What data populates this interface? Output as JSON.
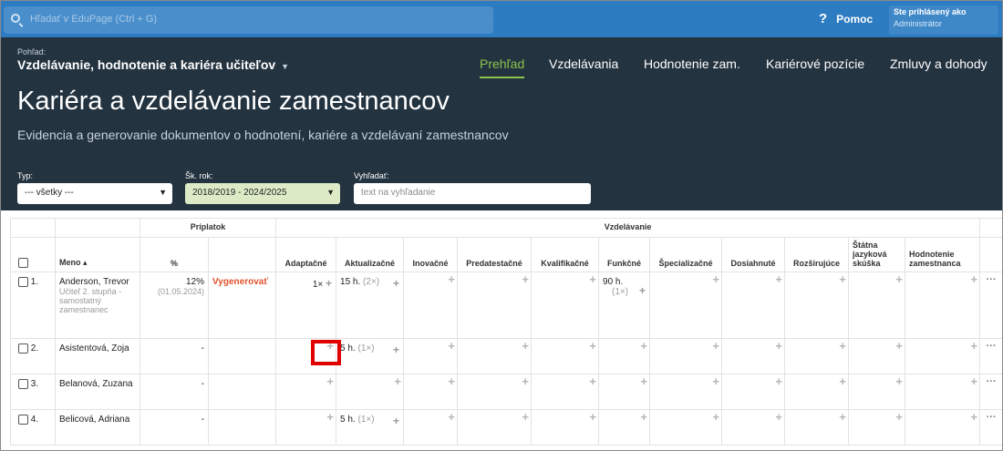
{
  "topbar": {
    "search_placeholder": "Hľadať v EduPage (Ctrl + G)",
    "help_label": "Pomoc",
    "help_icon": "?",
    "login_title": "Ste prihlásený ako",
    "login_role": "Administrátor"
  },
  "header": {
    "view_label": "Pohľad:",
    "view_title": "Vzdelávanie, hodnotenie a kariéra učiteľov",
    "tabs": [
      "Prehľad",
      "Vzdelávania",
      "Hodnotenie zam.",
      "Kariérové pozície",
      "Zmluvy a dohody"
    ],
    "page_title": "Kariéra a vzdelávanie zamestnancov",
    "subtitle": "Evidencia a generovanie dokumentov o hodnotení, kariére a vzdelávaní zamestnancov",
    "accent_color": "#8bc34a"
  },
  "filters": {
    "typ_label": "Typ:",
    "typ_value": "--- všetky ---",
    "rok_label": "Šk. rok:",
    "rok_value": "2018/2019 - 2024/2025",
    "search_label": "Vyhľadať:",
    "search_placeholder": "text na vyhľadanie"
  },
  "table": {
    "group_priplatok": "Príplatok",
    "group_vzdelavanie": "Vzdelávanie",
    "col_meno": "Meno ▴",
    "col_percent": "%",
    "cols": [
      "Adaptačné",
      "Aktualizačné",
      "Inovačné",
      "Predatestačné",
      "Kvalifikačné",
      "Funkčné",
      "Špecializačné",
      "Dosiahnuté",
      "Rozširujúce",
      "Štátna jazyková skúška",
      "Hodnotenie zamestnanca"
    ],
    "plus": "+",
    "dots": "···",
    "rows": [
      {
        "num": "1.",
        "name": "Anderson, Trevor",
        "role": "Učiteľ 2. stupňa - samostatný zamestnanec",
        "pct": "12%",
        "pct_date": "(01.05.2024)",
        "action": "Vygenerovať",
        "adapt": "1×",
        "aktual": "15 h.",
        "aktual_count": "(2×)",
        "funk": "90 h.",
        "funk_count": "(1×)"
      },
      {
        "num": "2.",
        "name": "Asistentová, Zoja",
        "role": "",
        "pct": "-",
        "pct_date": "",
        "action": "",
        "adapt": "",
        "aktual": "5 h.",
        "aktual_count": "(1×)",
        "funk": "",
        "funk_count": ""
      },
      {
        "num": "3.",
        "name": "Belanová, Zuzana",
        "role": "",
        "pct": "-",
        "pct_date": "",
        "action": "",
        "adapt": "",
        "aktual": "",
        "aktual_count": "",
        "funk": "",
        "funk_count": ""
      },
      {
        "num": "4.",
        "name": "Belicová, Adriana",
        "role": "",
        "pct": "-",
        "pct_date": "",
        "action": "",
        "adapt": "",
        "aktual": "5 h.",
        "aktual_count": "(1×)",
        "funk": "",
        "funk_count": ""
      }
    ]
  }
}
